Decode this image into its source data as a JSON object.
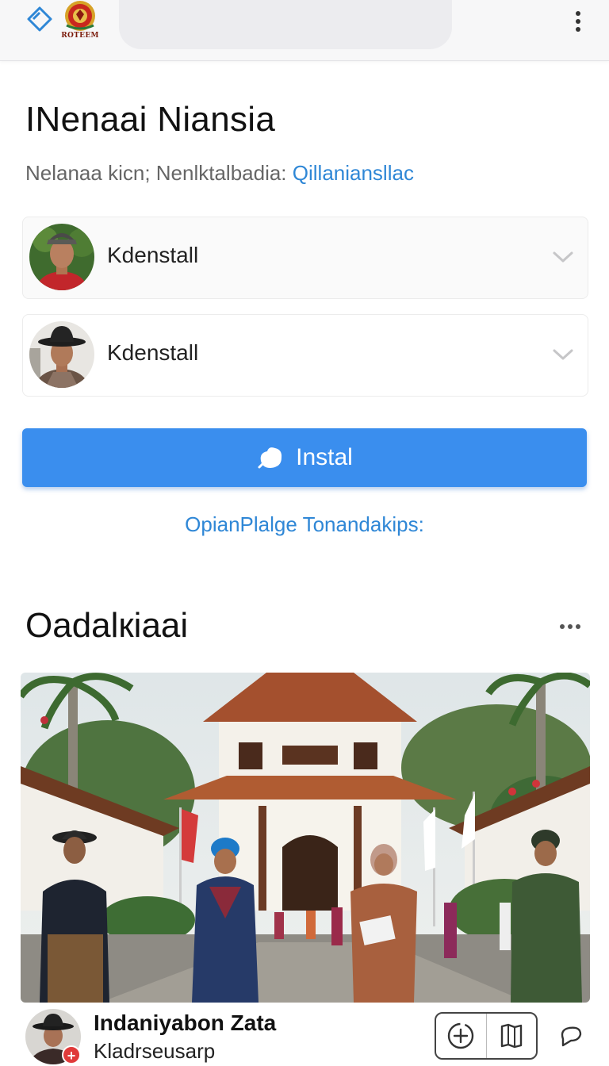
{
  "header": {
    "logo_text": "ROTEEM",
    "icons": [
      "back-diamond-icon",
      "emblem-logo",
      "kebab-menu-icon"
    ]
  },
  "page": {
    "title": "INenaai Niansia",
    "subtitle_prefix": "Nelanaa kicn; Nenlktalbadia: ",
    "subtitle_link": "Qillaniansllac"
  },
  "selects": [
    {
      "label": "Kdenstall",
      "icon": "chevron-down-icon"
    },
    {
      "label": "Kdenstall",
      "icon": "chevron-down-icon"
    }
  ],
  "install": {
    "label": "Instal",
    "icon": "blob-icon",
    "color": "#3a8eee"
  },
  "options_link": "OpianPlalge Tonandakips:",
  "section": {
    "title": "Oadalкiaai",
    "more_icon": "more-horizontal-icon"
  },
  "post": {
    "name": "Indaniyabon Zata",
    "subtitle": "Kladrseusarp",
    "badge": "+",
    "actions": [
      "add-circle-icon",
      "map-icon"
    ],
    "pin_icon": "pin-icon"
  },
  "colors": {
    "accent": "#3a8eee",
    "link": "#2f87d6",
    "badge": "#e03a3a"
  }
}
